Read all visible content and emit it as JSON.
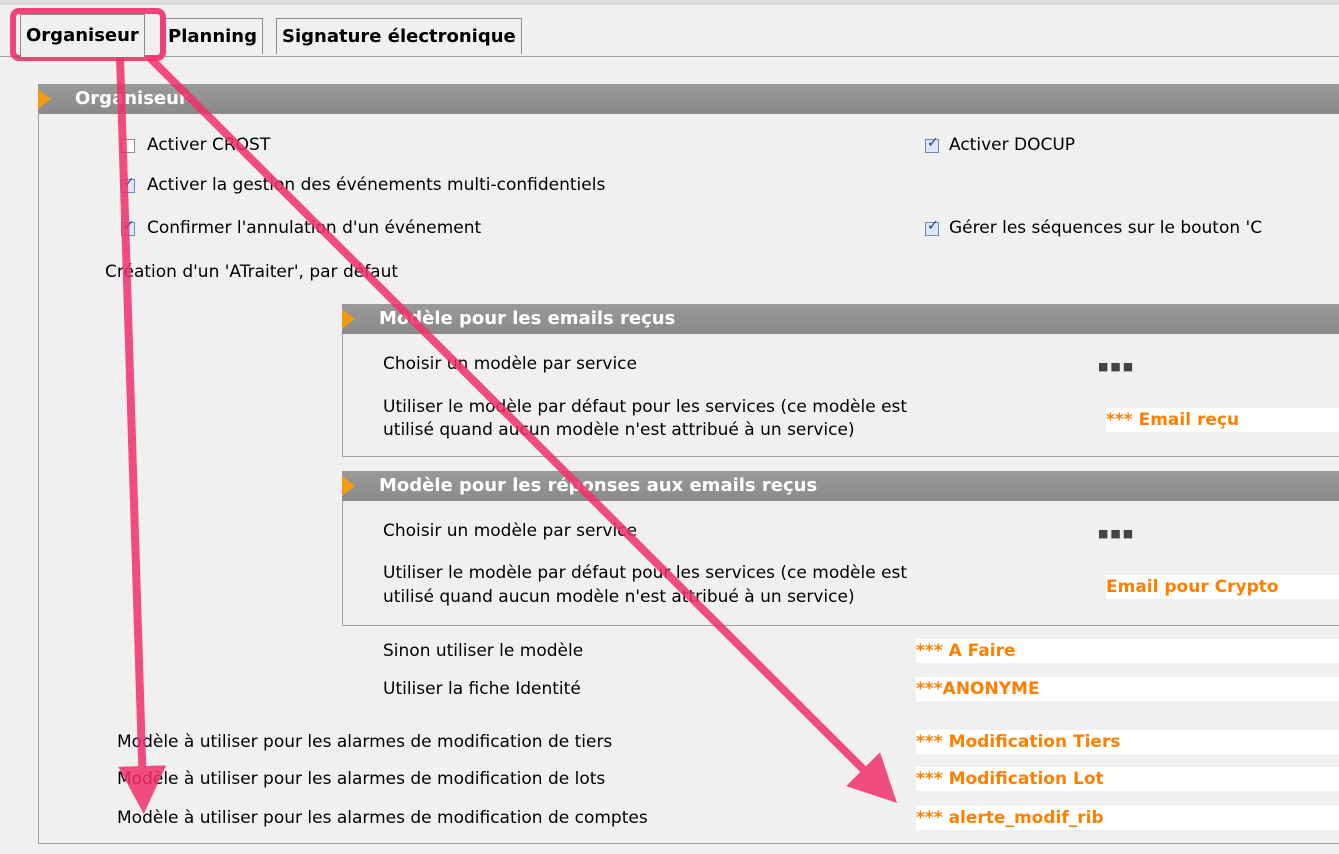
{
  "tabs": [
    {
      "label": "Organiseur"
    },
    {
      "label": "Planning"
    },
    {
      "label": "Signature électronique"
    }
  ],
  "section": {
    "title": "Organiseur"
  },
  "checkboxes": {
    "crost": {
      "label": "Activer CROST",
      "checked": false
    },
    "docup": {
      "label": "Activer DOCUP",
      "checked": true
    },
    "multi_conf": {
      "label": "Activer la gestion des événements multi-confidentiels",
      "checked": true
    },
    "confirm_cancel": {
      "label": "Confirmer l'annulation d'un événement",
      "checked": true
    },
    "sequences": {
      "label": "Gérer les séquences sur le bouton 'C",
      "checked": true
    }
  },
  "creation_label": "Création d'un 'ATraiter', par défaut",
  "emails_recus": {
    "title": "Modèle pour les emails reçus",
    "choose_label": "Choisir un modèle par service",
    "choose_button": "■■■",
    "default_label_1": "Utiliser le modèle par défaut pour les services (ce modèle est",
    "default_label_2": "utilisé quand aucun modèle n'est attribué à un service)",
    "default_value": "*** Email reçu"
  },
  "reponses_emails": {
    "title": "Modèle pour les réponses aux emails reçus",
    "choose_label": "Choisir un modèle par service",
    "choose_button": "■■■",
    "default_label_1": "Utiliser le modèle par défaut pour les services (ce modèle est",
    "default_label_2": "utilisé quand aucun modèle n'est attribué à un service)",
    "default_value": "Email pour Crypto"
  },
  "sinon": {
    "label": "Sinon utiliser le modèle",
    "value": "*** A Faire"
  },
  "identite": {
    "label": "Utiliser la fiche Identité",
    "value": "***ANONYME"
  },
  "alarms": [
    {
      "label": "Modèle à utiliser pour les alarmes de modification de tiers",
      "value": "*** Modification Tiers"
    },
    {
      "label": "Modèle à utiliser pour les alarmes de modification de lots",
      "value": "*** Modification Lot"
    },
    {
      "label": "Modèle à utiliser pour les alarmes de modification de comptes",
      "value": "*** alerte_modif_rib"
    }
  ],
  "colors": {
    "value_text": "#ff7f00",
    "annotation": "#f0306a",
    "section_bar": "#8f8f8f",
    "arrow": "#f39c12"
  }
}
